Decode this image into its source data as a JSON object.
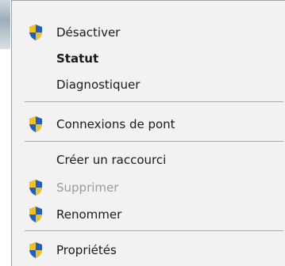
{
  "menu": {
    "items": [
      {
        "label": "Désactiver",
        "icon": "uac-shield-icon"
      },
      {
        "label": "Statut"
      },
      {
        "label": "Diagnostiquer"
      },
      {
        "label": "Connexions de pont",
        "icon": "uac-shield-icon"
      },
      {
        "label": "Créer un raccourci"
      },
      {
        "label": "Supprimer",
        "icon": "uac-shield-icon",
        "disabled": true
      },
      {
        "label": "Renommer",
        "icon": "uac-shield-icon"
      },
      {
        "label": "Propriétés",
        "icon": "uac-shield-icon"
      }
    ]
  },
  "colors": {
    "menu_background": "#f2f2f2",
    "separator": "#a9a9a9",
    "text": "#1a1a1a",
    "disabled_text": "#9b9b9b",
    "shield_blue": "#1f5fbf",
    "shield_yellow": "#f2c01b"
  }
}
